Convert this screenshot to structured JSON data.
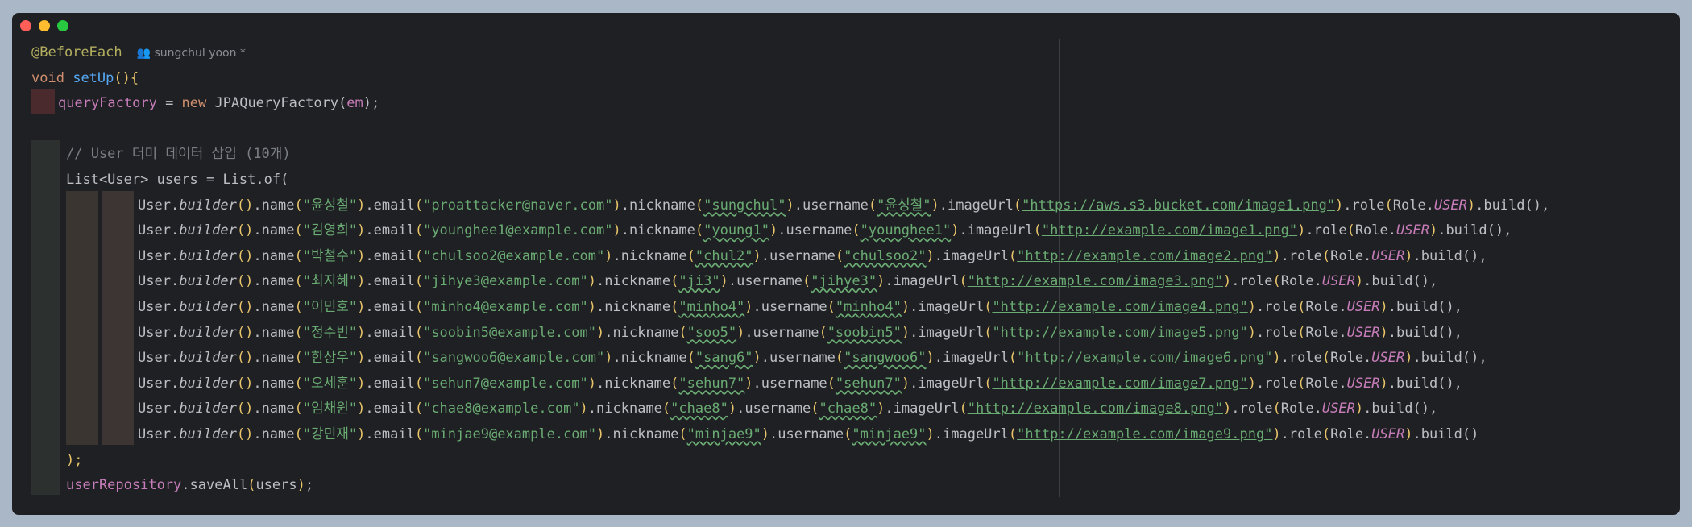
{
  "editor": {
    "annotation": "@BeforeEach",
    "author": "sungchul yoon *",
    "method_sig": [
      "void",
      "setUp",
      "(){"
    ],
    "line3": [
      "queryFactory",
      " = ",
      "new",
      " JPAQueryFactory(",
      "em",
      ");"
    ],
    "comment": "// User 더미 데이터 삽입 (10개)",
    "list_decl": "List<User> users = List.of(",
    "close_list": ");",
    "save_line": "userRepository.saveAll(users);",
    "users": [
      {
        "name": "\"윤성철\"",
        "email": "\"proattacker@naver.com\"",
        "nickname": "\"sungchul\"",
        "username": "\"윤성철\"",
        "imageUrl": "\"https://aws.s3.bucket.com/image1.png\"",
        "suffix": ".build(),"
      },
      {
        "name": "\"김영희\"",
        "email": "\"younghee1@example.com\"",
        "nickname": "\"young1\"",
        "username": "\"younghee1\"",
        "imageUrl": "\"http://example.com/image1.png\"",
        "suffix": ".build(),"
      },
      {
        "name": "\"박철수\"",
        "email": "\"chulsoo2@example.com\"",
        "nickname": "\"chul2\"",
        "username": "\"chulsoo2\"",
        "imageUrl": "\"http://example.com/image2.png\"",
        "suffix": ".build(),"
      },
      {
        "name": "\"최지혜\"",
        "email": "\"jihye3@example.com\"",
        "nickname": "\"ji3\"",
        "username": "\"jihye3\"",
        "imageUrl": "\"http://example.com/image3.png\"",
        "suffix": ".build(),"
      },
      {
        "name": "\"이민호\"",
        "email": "\"minho4@example.com\"",
        "nickname": "\"minho4\"",
        "username": "\"minho4\"",
        "imageUrl": "\"http://example.com/image4.png\"",
        "suffix": ".build(),"
      },
      {
        "name": "\"정수빈\"",
        "email": "\"soobin5@example.com\"",
        "nickname": "\"soo5\"",
        "username": "\"soobin5\"",
        "imageUrl": "\"http://example.com/image5.png\"",
        "suffix": ".build(),"
      },
      {
        "name": "\"한상우\"",
        "email": "\"sangwoo6@example.com\"",
        "nickname": "\"sang6\"",
        "username": "\"sangwoo6\"",
        "imageUrl": "\"http://example.com/image6.png\"",
        "suffix": ".build(),"
      },
      {
        "name": "\"오세훈\"",
        "email": "\"sehun7@example.com\"",
        "nickname": "\"sehun7\"",
        "username": "\"sehun7\"",
        "imageUrl": "\"http://example.com/image7.png\"",
        "suffix": ".build(),"
      },
      {
        "name": "\"임채원\"",
        "email": "\"chae8@example.com\"",
        "nickname": "\"chae8\"",
        "username": "\"chae8\"",
        "imageUrl": "\"http://example.com/image8.png\"",
        "suffix": ".build(),"
      },
      {
        "name": "\"강민재\"",
        "email": "\"minjae9@example.com\"",
        "nickname": "\"minjae9\"",
        "username": "\"minjae9\"",
        "imageUrl": "\"http://example.com/image9.png\"",
        "suffix": ".build()"
      }
    ]
  }
}
